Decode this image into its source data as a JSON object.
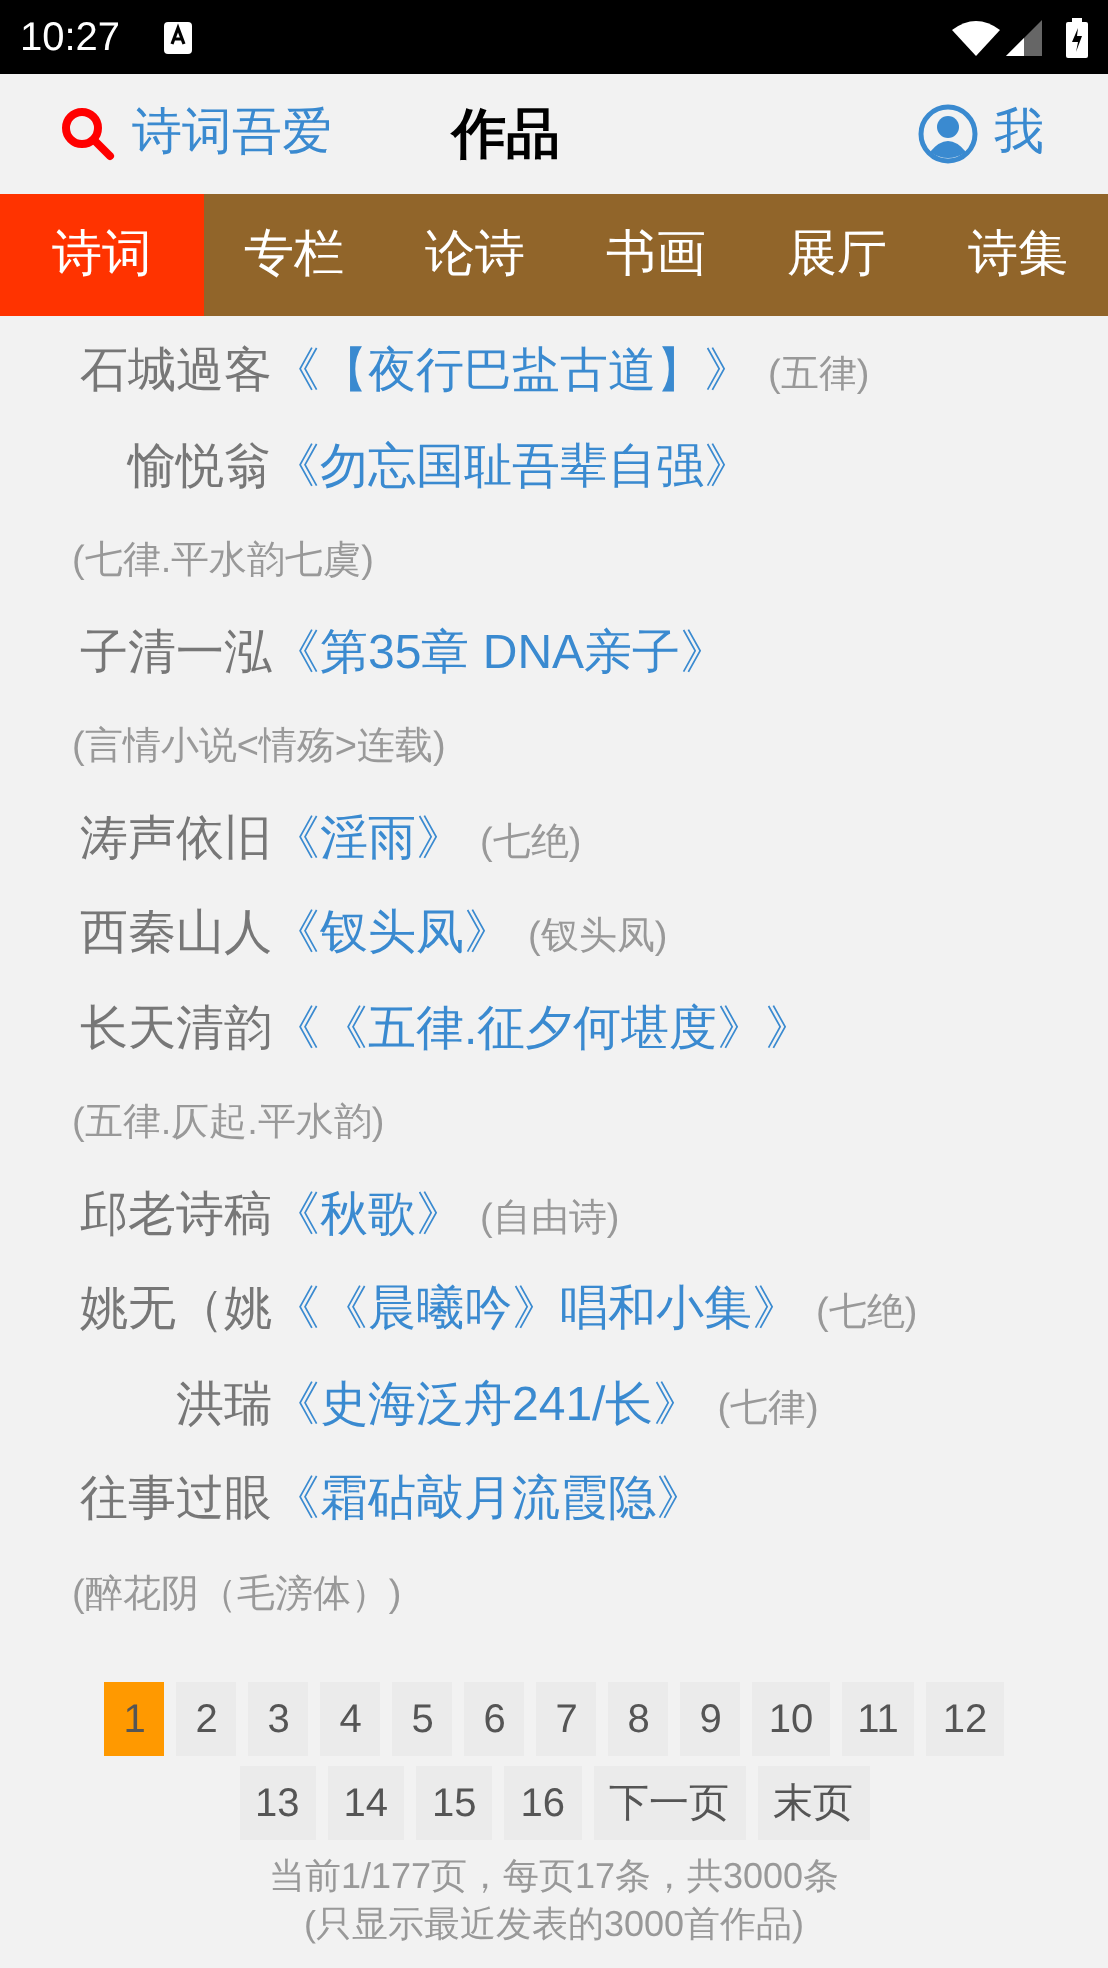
{
  "status_bar": {
    "time": "10:27"
  },
  "header": {
    "site_name": "诗词吾爱",
    "title": "作品",
    "user_label": "我"
  },
  "tabs": [
    {
      "label": "诗词",
      "selected": true
    },
    {
      "label": "专栏",
      "selected": false
    },
    {
      "label": "论诗",
      "selected": false
    },
    {
      "label": "书画",
      "selected": false
    },
    {
      "label": "展厅",
      "selected": false
    },
    {
      "label": "诗集",
      "selected": false
    }
  ],
  "works": [
    {
      "author": "石城過客",
      "title": "《【夜行巴盐古道】》",
      "note": "(五律)"
    },
    {
      "author": "愉悦翁",
      "title": "《勿忘国耻吾辈自强》",
      "note": "(七律.平水韵七虞)"
    },
    {
      "author": "子清一泓",
      "title": "《第35章 DNA亲子》",
      "note": "(言情小说<情殇>连载)"
    },
    {
      "author": "涛声依旧",
      "title": "《淫雨》",
      "note": "(七绝)"
    },
    {
      "author": "西秦山人",
      "title": "《钗头凤》",
      "note": "(钗头凤)"
    },
    {
      "author": "长天清韵",
      "title": "《《五律.征夕何堪度》》",
      "note": "(五律.仄起.平水韵)"
    },
    {
      "author": "邱老诗稿",
      "title": "《秋歌》",
      "note": "(自由诗)"
    },
    {
      "author": "姚无（姚",
      "title": "《《晨曦吟》唱和小集》",
      "note": "(七绝)"
    },
    {
      "author": "洪瑞",
      "title": "《史海泛舟241/长》",
      "note": "(七律)"
    },
    {
      "author": "往事过眼",
      "title": "《霜砧敲月流霞隐》",
      "note": "(醉花阴（毛滂体）)"
    }
  ],
  "pagination": {
    "pages": [
      {
        "label": "1",
        "selected": true
      },
      {
        "label": "2",
        "selected": false
      },
      {
        "label": "3",
        "selected": false
      },
      {
        "label": "4",
        "selected": false
      },
      {
        "label": "5",
        "selected": false
      },
      {
        "label": "6",
        "selected": false
      },
      {
        "label": "7",
        "selected": false
      },
      {
        "label": "8",
        "selected": false
      },
      {
        "label": "9",
        "selected": false
      },
      {
        "label": "10",
        "selected": false
      },
      {
        "label": "11",
        "selected": false
      },
      {
        "label": "12",
        "selected": false
      },
      {
        "label": "13",
        "selected": false
      },
      {
        "label": "14",
        "selected": false
      },
      {
        "label": "15",
        "selected": false
      },
      {
        "label": "16",
        "selected": false
      },
      {
        "label": "下一页",
        "selected": false
      },
      {
        "label": "末页",
        "selected": false
      }
    ],
    "summary": "当前1/177页，每页17条，共3000条",
    "footnote": "(只显示最近发表的3000首作品)"
  }
}
